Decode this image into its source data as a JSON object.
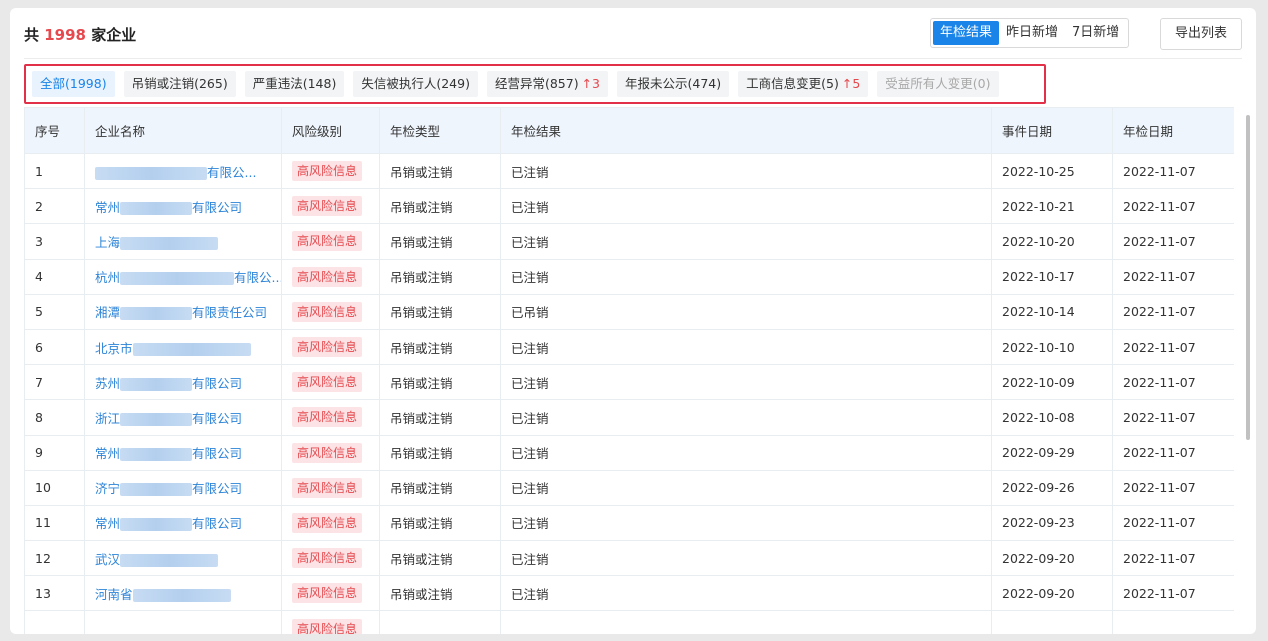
{
  "header": {
    "title_prefix": "共",
    "title_count": "1998",
    "title_suffix": "家企业",
    "segments": [
      {
        "label": "年检结果",
        "active": true
      },
      {
        "label": "昨日新增",
        "active": false
      },
      {
        "label": "7日新增",
        "active": false
      }
    ],
    "export_label": "导出列表"
  },
  "filters": [
    {
      "label": "全部(1998)",
      "active": true
    },
    {
      "label": "吊销或注销(265)"
    },
    {
      "label": "严重违法(148)"
    },
    {
      "label": "失信被执行人(249)"
    },
    {
      "label": "经营异常(857)",
      "increase": "↑3"
    },
    {
      "label": "年报未公示(474)"
    },
    {
      "label": "工商信息变更(5)",
      "increase": "↑5"
    },
    {
      "label": "受益所有人变更(0)",
      "disabled": true
    }
  ],
  "table": {
    "columns": [
      "序号",
      "企业名称",
      "风险级别",
      "年检类型",
      "年检结果",
      "事件日期",
      "年检日期"
    ],
    "rows": [
      {
        "no": "1",
        "name_pre": "",
        "name_post": "有限公...",
        "risk": "高风险信息",
        "type": "吊销或注销",
        "result": "已注销",
        "event_date": "2022-10-25",
        "check_date": "2022-11-07"
      },
      {
        "no": "2",
        "name_pre": "常州",
        "name_post": "有限公司",
        "risk": "高风险信息",
        "type": "吊销或注销",
        "result": "已注销",
        "event_date": "2022-10-21",
        "check_date": "2022-11-07"
      },
      {
        "no": "3",
        "name_pre": "上海",
        "name_post": "",
        "risk": "高风险信息",
        "type": "吊销或注销",
        "result": "已注销",
        "event_date": "2022-10-20",
        "check_date": "2022-11-07"
      },
      {
        "no": "4",
        "name_pre": "杭州",
        "name_post": "有限公...",
        "risk": "高风险信息",
        "type": "吊销或注销",
        "result": "已注销",
        "event_date": "2022-10-17",
        "check_date": "2022-11-07"
      },
      {
        "no": "5",
        "name_pre": "湘潭",
        "name_post": "有限责任公司",
        "risk": "高风险信息",
        "type": "吊销或注销",
        "result": "已吊销",
        "event_date": "2022-10-14",
        "check_date": "2022-11-07"
      },
      {
        "no": "6",
        "name_pre": "北京市",
        "name_post": "",
        "risk": "高风险信息",
        "type": "吊销或注销",
        "result": "已注销",
        "event_date": "2022-10-10",
        "check_date": "2022-11-07"
      },
      {
        "no": "7",
        "name_pre": "苏州",
        "name_post": "有限公司",
        "risk": "高风险信息",
        "type": "吊销或注销",
        "result": "已注销",
        "event_date": "2022-10-09",
        "check_date": "2022-11-07"
      },
      {
        "no": "8",
        "name_pre": "浙江",
        "name_post": "有限公司",
        "risk": "高风险信息",
        "type": "吊销或注销",
        "result": "已注销",
        "event_date": "2022-10-08",
        "check_date": "2022-11-07"
      },
      {
        "no": "9",
        "name_pre": "常州",
        "name_post": "有限公司",
        "risk": "高风险信息",
        "type": "吊销或注销",
        "result": "已注销",
        "event_date": "2022-09-29",
        "check_date": "2022-11-07"
      },
      {
        "no": "10",
        "name_pre": "济宁",
        "name_post": "有限公司",
        "risk": "高风险信息",
        "type": "吊销或注销",
        "result": "已注销",
        "event_date": "2022-09-26",
        "check_date": "2022-11-07"
      },
      {
        "no": "11",
        "name_pre": "常州",
        "name_post": "有限公司",
        "risk": "高风险信息",
        "type": "吊销或注销",
        "result": "已注销",
        "event_date": "2022-09-23",
        "check_date": "2022-11-07"
      },
      {
        "no": "12",
        "name_pre": "武汉",
        "name_post": "",
        "risk": "高风险信息",
        "type": "吊销或注销",
        "result": "已注销",
        "event_date": "2022-09-20",
        "check_date": "2022-11-07"
      },
      {
        "no": "13",
        "name_pre": "河南省",
        "name_post": "",
        "risk": "高风险信息",
        "type": "吊销或注销",
        "result": "已注销",
        "event_date": "2022-09-20",
        "check_date": "2022-11-07"
      },
      {
        "no": "",
        "name_pre": "",
        "name_post": "",
        "risk": "高风险信息",
        "type": "",
        "result": "",
        "event_date": "",
        "check_date": ""
      }
    ]
  },
  "colors": {
    "accent": "#1a84e8",
    "danger": "#e5484d",
    "highlight_border": "#e23049",
    "header_bg": "#eef5fc"
  }
}
